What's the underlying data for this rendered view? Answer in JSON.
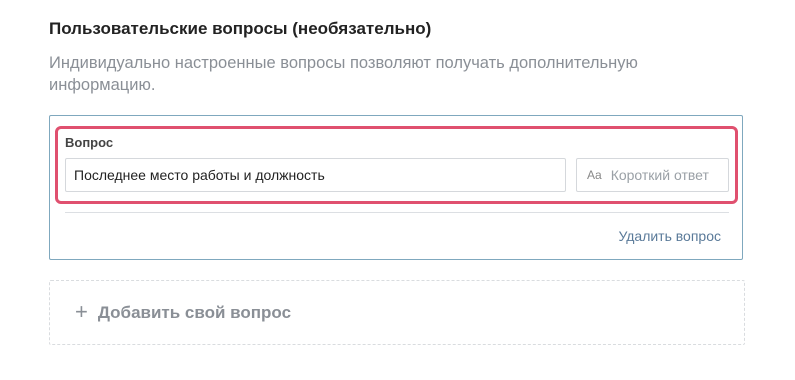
{
  "section": {
    "title": "Пользовательские вопросы (необязательно)",
    "description": "Индивидуально настроенные вопросы позволяют получать дополнительную информацию."
  },
  "question": {
    "label": "Вопрос",
    "value": "Последнее место работы и должность",
    "type_icon": "Aa",
    "type_label": "Короткий ответ",
    "delete_label": "Удалить вопрос"
  },
  "add_question": {
    "icon": "+",
    "label": "Добавить свой вопрос"
  },
  "colors": {
    "highlight": "#e0506f",
    "card_border": "#7fa8be",
    "link": "#5a7a99",
    "muted_text": "#8a8f96"
  }
}
